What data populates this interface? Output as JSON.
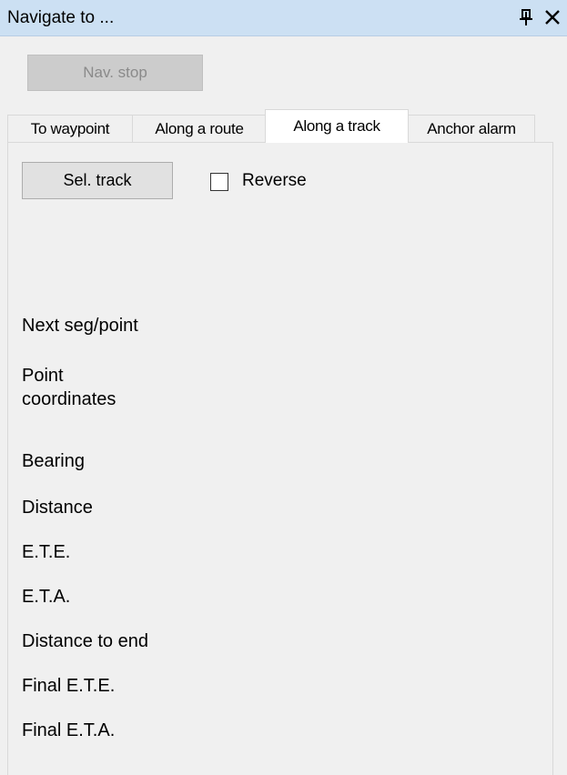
{
  "window": {
    "title": "Navigate to ..."
  },
  "icons": {
    "pin": "pin-icon",
    "close": "close-icon"
  },
  "toolbar": {
    "nav_stop_label": "Nav. stop"
  },
  "tabs": [
    {
      "label": "To waypoint",
      "active": false
    },
    {
      "label": "Along a route",
      "active": false
    },
    {
      "label": "Along a track",
      "active": true
    },
    {
      "label": "Anchor alarm",
      "active": false
    }
  ],
  "track_panel": {
    "select_button_label": "Sel. track",
    "reverse_label": "Reverse",
    "reverse_checked": false,
    "fields": [
      {
        "label": "Next seg/point"
      },
      {
        "label": "Point\ncoordinates"
      },
      {
        "label": "Bearing"
      },
      {
        "label": "Distance"
      },
      {
        "label": "E.T.E."
      },
      {
        "label": "E.T.A."
      },
      {
        "label": "Distance to end"
      },
      {
        "label": "Final E.T.E."
      },
      {
        "label": "Final E.T.A."
      }
    ]
  },
  "colors": {
    "titlebar": "#cce0f3",
    "background": "#f0f0f0",
    "active_tab": "#ffffff"
  }
}
